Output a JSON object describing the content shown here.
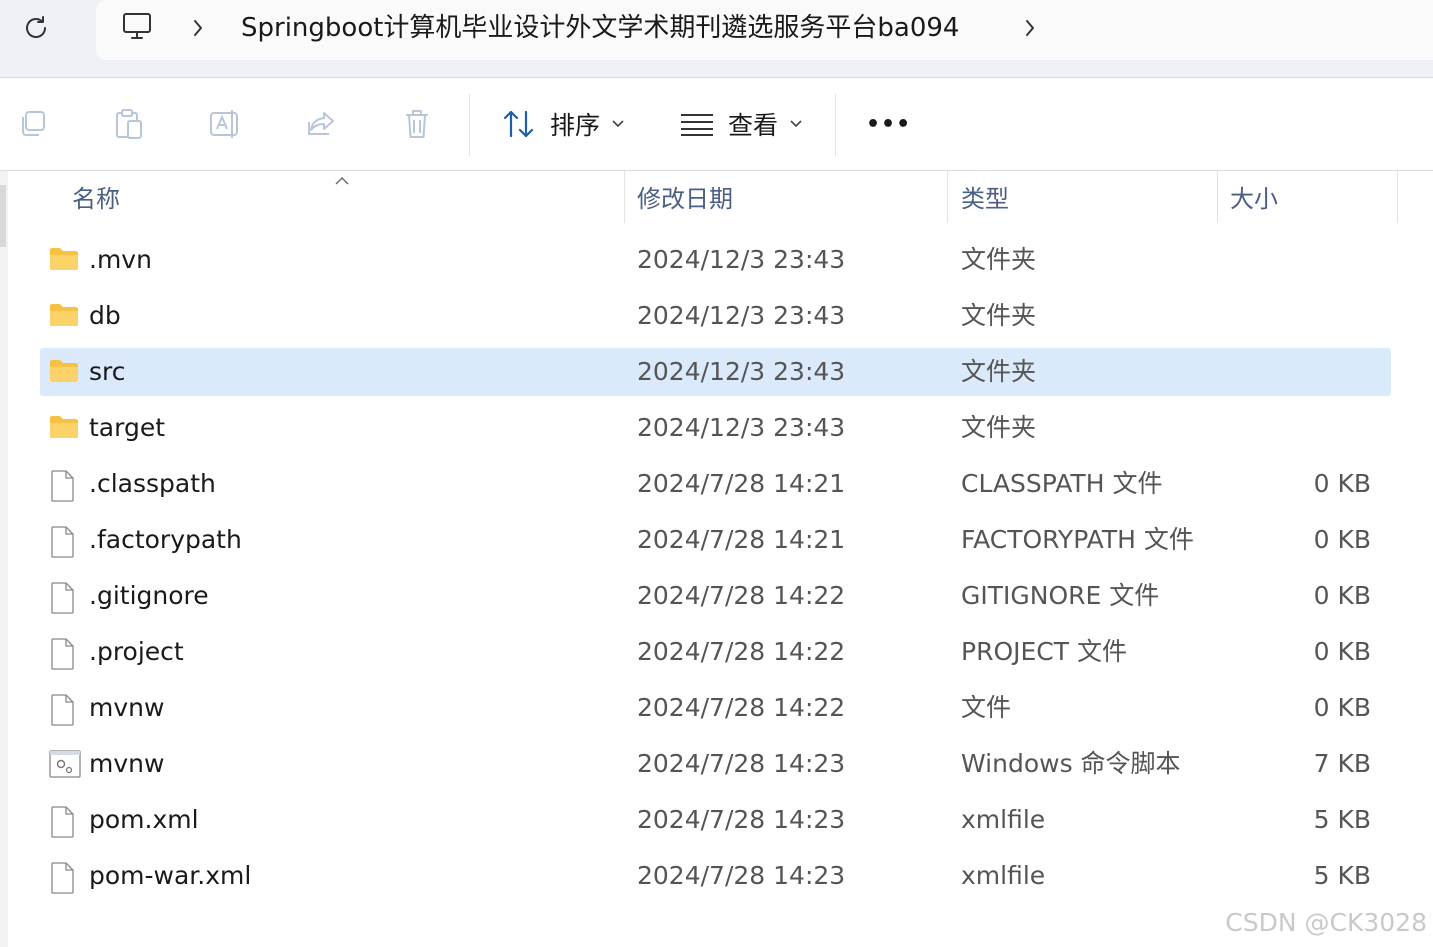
{
  "address_bar": {
    "path": "Springboot计算机毕业设计外文学术期刊遴选服务平台ba094"
  },
  "toolbar": {
    "sort_label": "排序",
    "view_label": "查看",
    "more_label": "•••"
  },
  "columns": {
    "name": "名称",
    "date": "修改日期",
    "type": "类型",
    "size": "大小"
  },
  "files": [
    {
      "name": ".mvn",
      "date": "2024/12/3 23:43",
      "type": "文件夹",
      "size": "",
      "icon": "folder-icon",
      "selected": false
    },
    {
      "name": "db",
      "date": "2024/12/3 23:43",
      "type": "文件夹",
      "size": "",
      "icon": "folder-icon",
      "selected": false
    },
    {
      "name": "src",
      "date": "2024/12/3 23:43",
      "type": "文件夹",
      "size": "",
      "icon": "folder-icon",
      "selected": true
    },
    {
      "name": "target",
      "date": "2024/12/3 23:43",
      "type": "文件夹",
      "size": "",
      "icon": "folder-icon",
      "selected": false
    },
    {
      "name": ".classpath",
      "date": "2024/7/28 14:21",
      "type": "CLASSPATH 文件",
      "size": "0 KB",
      "icon": "file-icon",
      "selected": false
    },
    {
      "name": ".factorypath",
      "date": "2024/7/28 14:21",
      "type": "FACTORYPATH 文件",
      "size": "0 KB",
      "icon": "file-icon",
      "selected": false
    },
    {
      "name": ".gitignore",
      "date": "2024/7/28 14:22",
      "type": "GITIGNORE 文件",
      "size": "0 KB",
      "icon": "file-icon",
      "selected": false
    },
    {
      "name": ".project",
      "date": "2024/7/28 14:22",
      "type": "PROJECT 文件",
      "size": "0 KB",
      "icon": "file-icon",
      "selected": false
    },
    {
      "name": "mvnw",
      "date": "2024/7/28 14:22",
      "type": "文件",
      "size": "0 KB",
      "icon": "file-icon",
      "selected": false
    },
    {
      "name": "mvnw",
      "date": "2024/7/28 14:23",
      "type": "Windows 命令脚本",
      "size": "7 KB",
      "icon": "script-icon",
      "selected": false
    },
    {
      "name": "pom.xml",
      "date": "2024/7/28 14:23",
      "type": "xmlfile",
      "size": "5 KB",
      "icon": "file-icon",
      "selected": false
    },
    {
      "name": "pom-war.xml",
      "date": "2024/7/28 14:23",
      "type": "xmlfile",
      "size": "5 KB",
      "icon": "file-icon",
      "selected": false
    }
  ],
  "watermark": "CSDN @CK3028",
  "colors": {
    "selection": "#dbeafb",
    "header_text": "#4a5f86",
    "folder": "#f7c243"
  }
}
